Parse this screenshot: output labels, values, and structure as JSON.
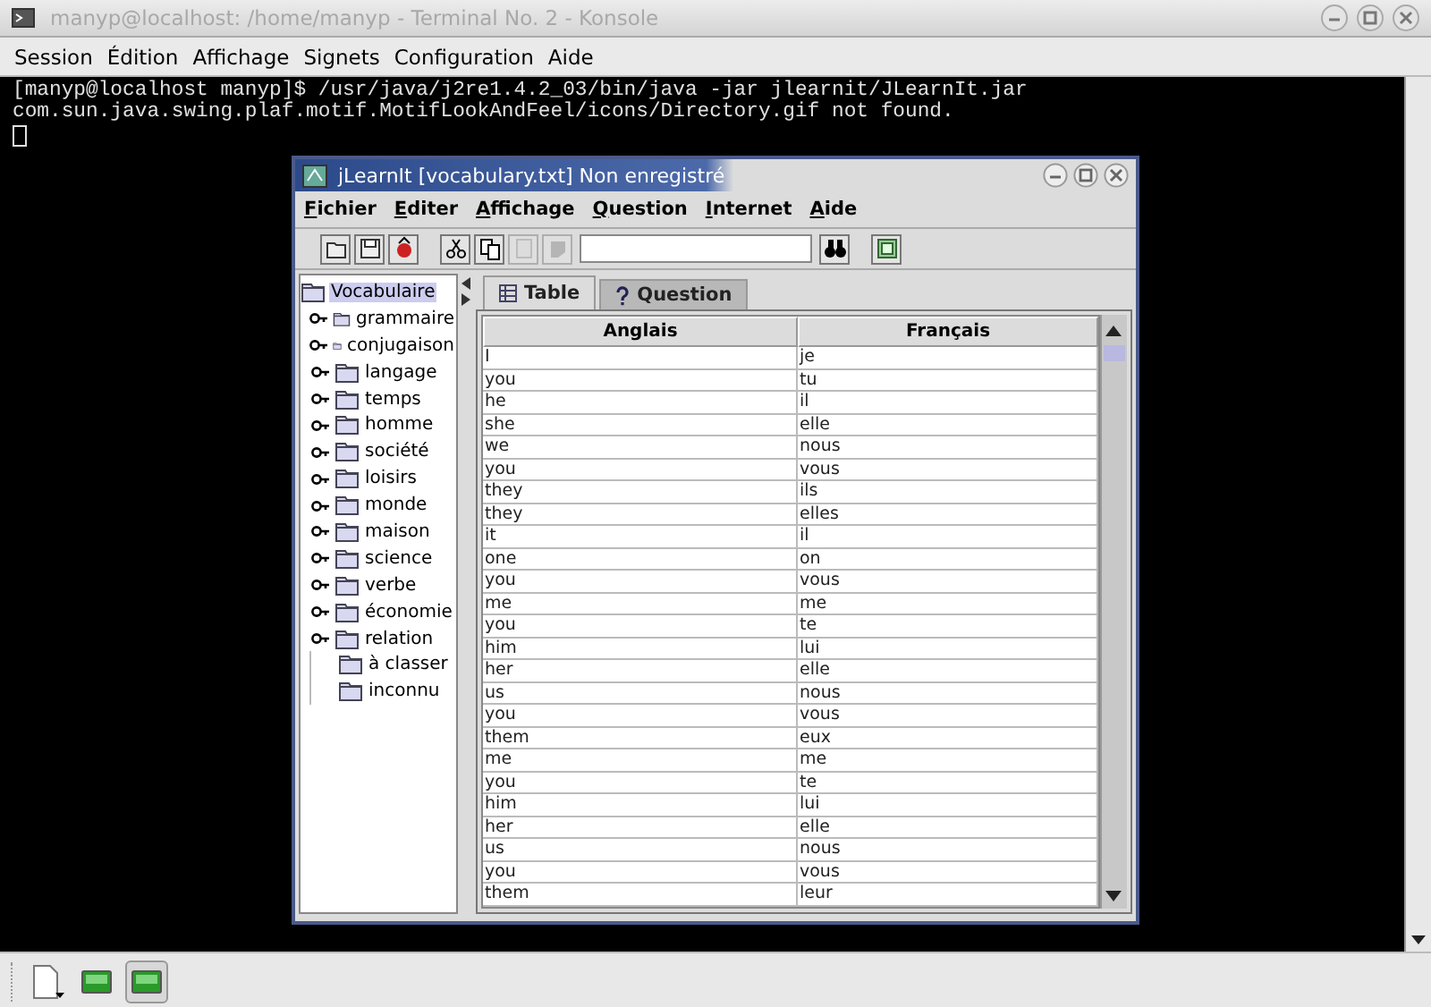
{
  "konsole": {
    "title": "manyp@localhost: /home/manyp - Terminal No. 2 - Konsole",
    "menu": [
      "Session",
      "Édition",
      "Affichage",
      "Signets",
      "Configuration",
      "Aide"
    ],
    "terminal_lines": [
      "[manyp@localhost manyp]$ /usr/java/j2re1.4.2_03/bin/java -jar jlearnit/JLearnIt.jar",
      "com.sun.java.swing.plaf.motif.MotifLookAndFeel/icons/Directory.gif not found."
    ],
    "bottom_tabs": [
      {
        "selected": false
      },
      {
        "selected": true
      }
    ]
  },
  "jlearnit": {
    "title": "jLearnIt [vocabulary.txt] Non enregistré",
    "menu": [
      "Fichier",
      "Editer",
      "Affichage",
      "Question",
      "Internet",
      "Aide"
    ],
    "toolbar": [
      {
        "kind": "open",
        "disabled": false
      },
      {
        "kind": "save",
        "disabled": false
      },
      {
        "kind": "web",
        "disabled": false
      },
      {
        "kind": "gap"
      },
      {
        "kind": "cut",
        "disabled": false
      },
      {
        "kind": "copy",
        "disabled": false
      },
      {
        "kind": "paste",
        "disabled": true
      },
      {
        "kind": "delete",
        "disabled": true
      },
      {
        "kind": "search"
      },
      {
        "kind": "find",
        "disabled": false
      },
      {
        "kind": "gap"
      },
      {
        "kind": "question",
        "disabled": false
      }
    ],
    "tree": {
      "label": "Vocabulaire",
      "selected": true,
      "children": [
        {
          "label": "grammaire",
          "kind": "branch",
          "selected": false
        },
        {
          "label": "conjugaison",
          "kind": "branch",
          "selected": false
        },
        {
          "label": "langage",
          "kind": "branch",
          "selected": false
        },
        {
          "label": "temps",
          "kind": "branch",
          "selected": false
        },
        {
          "label": "homme",
          "kind": "branch",
          "selected": false
        },
        {
          "label": "société",
          "kind": "branch",
          "selected": false
        },
        {
          "label": "loisirs",
          "kind": "branch",
          "selected": false
        },
        {
          "label": "monde",
          "kind": "branch",
          "selected": false
        },
        {
          "label": "maison",
          "kind": "branch",
          "selected": false
        },
        {
          "label": "science",
          "kind": "branch",
          "selected": false
        },
        {
          "label": "verbe",
          "kind": "branch",
          "selected": false
        },
        {
          "label": "économie",
          "kind": "branch",
          "selected": false
        },
        {
          "label": "relation",
          "kind": "branch",
          "selected": false
        },
        {
          "label": "à classer",
          "kind": "leaf",
          "selected": false
        },
        {
          "label": "inconnu",
          "kind": "leaf",
          "selected": false
        }
      ]
    },
    "tabs": [
      {
        "label": "Table",
        "kind": "table",
        "selected": true
      },
      {
        "label": "Question",
        "kind": "question",
        "selected": false
      }
    ],
    "table": {
      "columns": [
        "Anglais",
        "Français"
      ],
      "rows": [
        [
          "I",
          "je"
        ],
        [
          "you",
          "tu"
        ],
        [
          "he",
          "il"
        ],
        [
          "she",
          "elle"
        ],
        [
          "we",
          "nous"
        ],
        [
          "you",
          "vous"
        ],
        [
          "they",
          "ils"
        ],
        [
          "they",
          "elles"
        ],
        [
          "it",
          "il"
        ],
        [
          "one",
          "on"
        ],
        [
          "you",
          "vous"
        ],
        [
          "me",
          "me"
        ],
        [
          "you",
          "te"
        ],
        [
          "him",
          "lui"
        ],
        [
          "her",
          "elle"
        ],
        [
          "us",
          "nous"
        ],
        [
          "you",
          "vous"
        ],
        [
          "them",
          "eux"
        ],
        [
          "me",
          "me"
        ],
        [
          "you",
          "te"
        ],
        [
          "him",
          "lui"
        ],
        [
          "her",
          "elle"
        ],
        [
          "us",
          "nous"
        ],
        [
          "you",
          "vous"
        ],
        [
          "them",
          "leur"
        ]
      ]
    }
  }
}
